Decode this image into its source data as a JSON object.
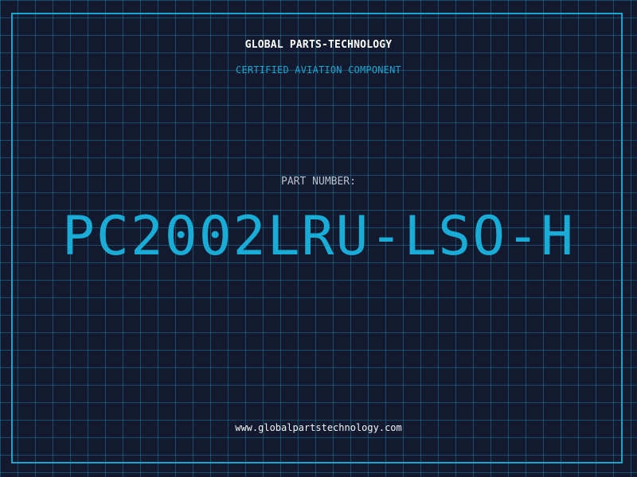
{
  "header": {
    "company_name": "GLOBAL PARTS-TECHNOLOGY",
    "subtitle": "CERTIFIED AVIATION COMPONENT"
  },
  "part": {
    "label": "PART NUMBER:",
    "number": "PC2002LRU-LSO-H"
  },
  "footer": {
    "website": "www.globalpartstechnology.com"
  },
  "colors": {
    "background": "#13192e",
    "grid": "#187896",
    "accent": "#17a6cf",
    "text_primary": "#ffffff",
    "text_secondary": "#b8c2cf"
  }
}
